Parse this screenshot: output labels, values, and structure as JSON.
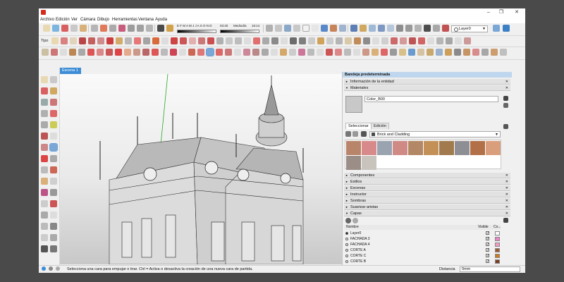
{
  "menu": [
    "Archivo",
    "Edición",
    "Ver",
    "Cámara",
    "Dibujo",
    "Herramientas",
    "Ventana",
    "Ayuda"
  ],
  "toolbar": {
    "tipo_label": "Tipo",
    "layer_current": "Layer0",
    "shadow_time": "03:40",
    "shadow_label": "Mediodía",
    "shadow_right": "16:14",
    "months": "E F M A M J J A S O N D"
  },
  "scene": {
    "tab_label": "Escena 1"
  },
  "tray": {
    "title": "Bandeja predeterminada",
    "entity_info": "Información de la entidad",
    "materials": {
      "title": "Materiales",
      "current_name": "Color_B00",
      "tabs": [
        "Seleccionar",
        "Edición"
      ],
      "category": "Brick and Cladding",
      "swatch_colors": [
        "#b9856a",
        "#d88a8a",
        "#9aa3b0",
        "#cf8a86",
        "#b38866",
        "#c39158",
        "#a17a4e",
        "#8e8f95",
        "#b27049",
        "#d99f7d",
        "#9a8e86",
        "#c9c3bd"
      ]
    },
    "collapsed_sections": [
      "Componentes",
      "Estilos",
      "Escenas",
      "Instructor",
      "Sombras",
      "Suavizar aristas"
    ],
    "layers": {
      "title": "Capas",
      "col_name": "Nombre",
      "col_visible": "Visible",
      "col_color": "Co...",
      "rows": [
        {
          "name": "Layer0",
          "active": true,
          "visible": true,
          "color": "#ffffff"
        },
        {
          "name": "FACHADA 3",
          "active": false,
          "visible": true,
          "color": "#ee82c8"
        },
        {
          "name": "FACHADA 4",
          "active": false,
          "visible": true,
          "color": "#f29ac0"
        },
        {
          "name": "CORTE A",
          "active": false,
          "visible": true,
          "color": "#9a5c2e"
        },
        {
          "name": "CORTE C",
          "active": false,
          "visible": true,
          "color": "#d37a18"
        },
        {
          "name": "CORTE B",
          "active": false,
          "visible": true,
          "color": "#7a3e20"
        }
      ]
    }
  },
  "status": {
    "hint": "Selecciona una cara para empujar o tirar. Ctrl = Activa o desactiva la creación de una nueva cara de partida.",
    "distance_label": "Distancia",
    "distance_value": "0mm"
  },
  "colors": {
    "accent": "#3c8dd6",
    "axis_green": "#2aa52a"
  }
}
